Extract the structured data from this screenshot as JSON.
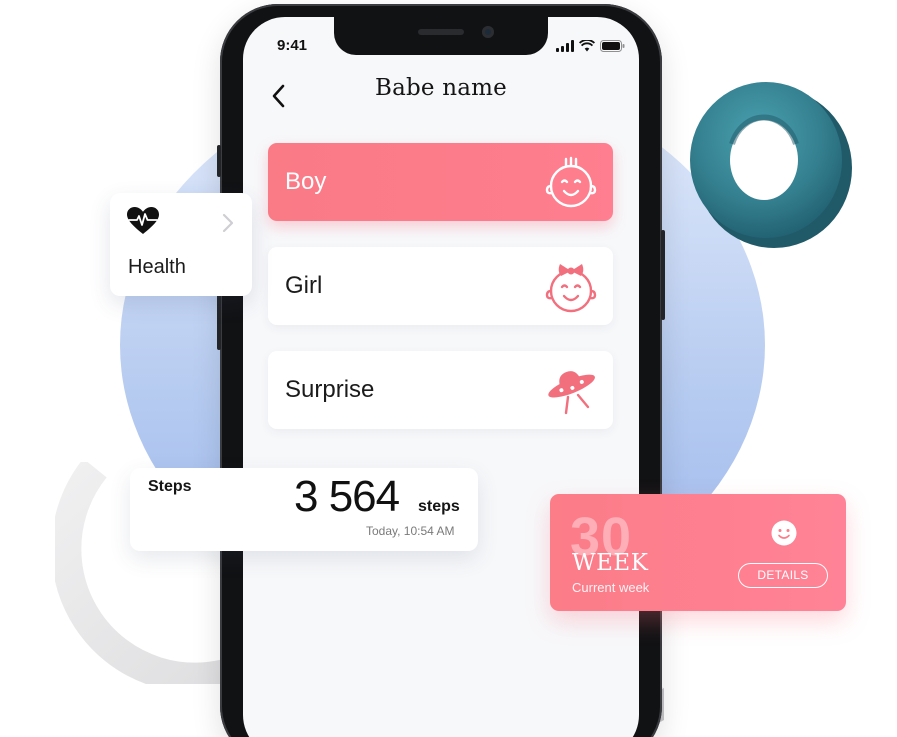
{
  "status_bar": {
    "time": "9:41"
  },
  "app": {
    "title": "Babe name"
  },
  "options": [
    {
      "label": "Boy",
      "icon": "baby-boy-icon",
      "selected": true
    },
    {
      "label": "Girl",
      "icon": "baby-girl-icon",
      "selected": false
    },
    {
      "label": "Surprise",
      "icon": "ufo-icon",
      "selected": false
    }
  ],
  "health_card": {
    "label": "Health",
    "icon": "heart-pulse-icon"
  },
  "steps_card": {
    "title": "Steps",
    "value": "3 564",
    "unit": "steps",
    "timestamp": "Today, 10:54 AM"
  },
  "week_card": {
    "number": "30",
    "label": "WEEK",
    "subtitle": "Current week",
    "button_label": "DETAILS"
  },
  "colors": {
    "accent": "#fc7c88",
    "accent_dark": "#f26a78",
    "teal": "#3e8b9a",
    "background_circle": "#b9cdf1"
  }
}
